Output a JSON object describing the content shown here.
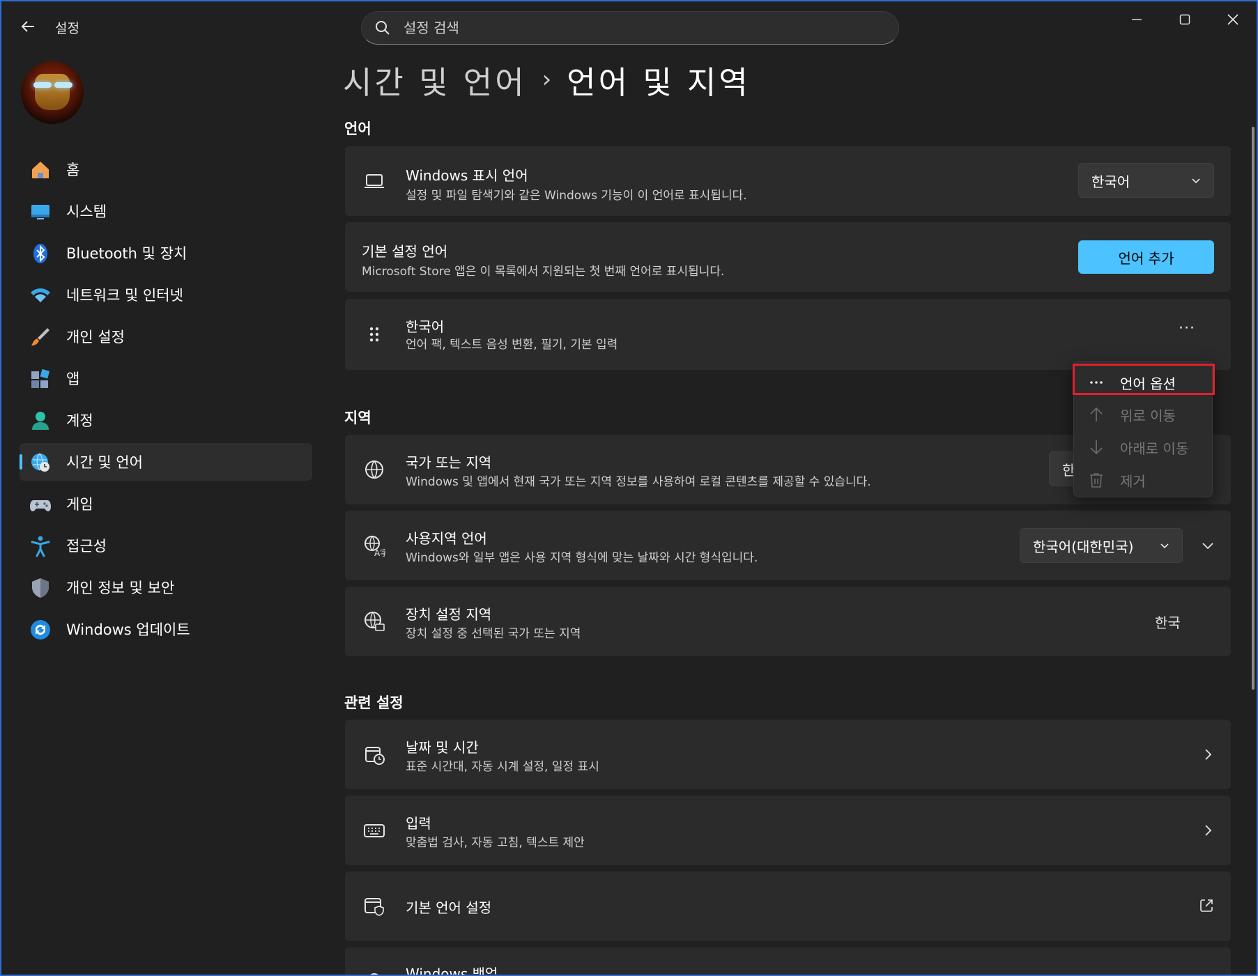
{
  "app": {
    "title": "설정"
  },
  "search": {
    "placeholder": "설정 검색"
  },
  "user": {
    "avatar": "avatar"
  },
  "sidebar": {
    "items": [
      {
        "label": "홈",
        "icon": "home-icon"
      },
      {
        "label": "시스템",
        "icon": "system-icon"
      },
      {
        "label": "Bluetooth 및 장치",
        "icon": "bluetooth-icon"
      },
      {
        "label": "네트워크 및 인터넷",
        "icon": "wifi-icon"
      },
      {
        "label": "개인 설정",
        "icon": "brush-icon"
      },
      {
        "label": "앱",
        "icon": "apps-icon"
      },
      {
        "label": "계정",
        "icon": "account-icon"
      },
      {
        "label": "시간 및 언어",
        "icon": "time-language-icon",
        "active": true
      },
      {
        "label": "게임",
        "icon": "gamepad-icon"
      },
      {
        "label": "접근성",
        "icon": "accessibility-icon"
      },
      {
        "label": "개인 정보 및 보안",
        "icon": "shield-icon"
      },
      {
        "label": "Windows 업데이트",
        "icon": "update-icon"
      }
    ]
  },
  "breadcrumb": {
    "parent": "시간 및 언어",
    "separator": "›",
    "current": "언어 및 지역"
  },
  "sections": {
    "language": "언어",
    "region": "지역",
    "related": "관련 설정"
  },
  "language": {
    "display": {
      "title": "Windows 표시 언어",
      "desc": "설정 및 파일 탐색기와 같은 Windows 기능이 이 언어로 표시됩니다.",
      "value": "한국어"
    },
    "preferred": {
      "title": "기본 설정 언어",
      "desc": "Microsoft Store 앱은 이 목록에서 지원되는 첫 번째 언어로 표시됩니다.",
      "button": "언어 추가"
    },
    "korean": {
      "title": "한국어",
      "desc": "언어 팩, 텍스트 음성 변환, 필기, 기본 입력",
      "more": "···"
    }
  },
  "context_menu": {
    "items": [
      {
        "label": "언어 옵션",
        "icon": "more-icon",
        "disabled": false
      },
      {
        "label": "위로 이동",
        "icon": "arrow-up-icon",
        "disabled": true
      },
      {
        "label": "아래로 이동",
        "icon": "arrow-down-icon",
        "disabled": true
      },
      {
        "label": "제거",
        "icon": "trash-icon",
        "disabled": true
      }
    ]
  },
  "region": {
    "country": {
      "title": "국가 또는 지역",
      "desc": "Windows 및 앱에서 현재 국가 또는 지역 정보를 사용하여 로컬 콘텐츠를 제공할 수 있습니다.",
      "value": "한"
    },
    "regional_format": {
      "title": "사용지역 언어",
      "desc": "Windows와 일부 앱은 사용 지역 형식에 맞는 날짜와 시간 형식입니다.",
      "value": "한국어(대한민국)"
    },
    "device_region": {
      "title": "장치 설정 지역",
      "desc": "장치 설정 중 선택된 국가 또는 지역",
      "value": "한국"
    }
  },
  "related": {
    "datetime": {
      "title": "날짜 및 시간",
      "desc": "표준 시간대, 자동 시계 설정, 일정 표시"
    },
    "typing": {
      "title": "입력",
      "desc": "맞춤법 검사, 자동 고침, 텍스트 제안"
    },
    "admin": {
      "title": "기본 언어 설정"
    },
    "backup": {
      "title": "Windows 백업"
    }
  },
  "colors": {
    "accent": "#4cc2ff",
    "background": "#202020",
    "card": "#2b2b2b",
    "highlight": "#e0202a"
  }
}
